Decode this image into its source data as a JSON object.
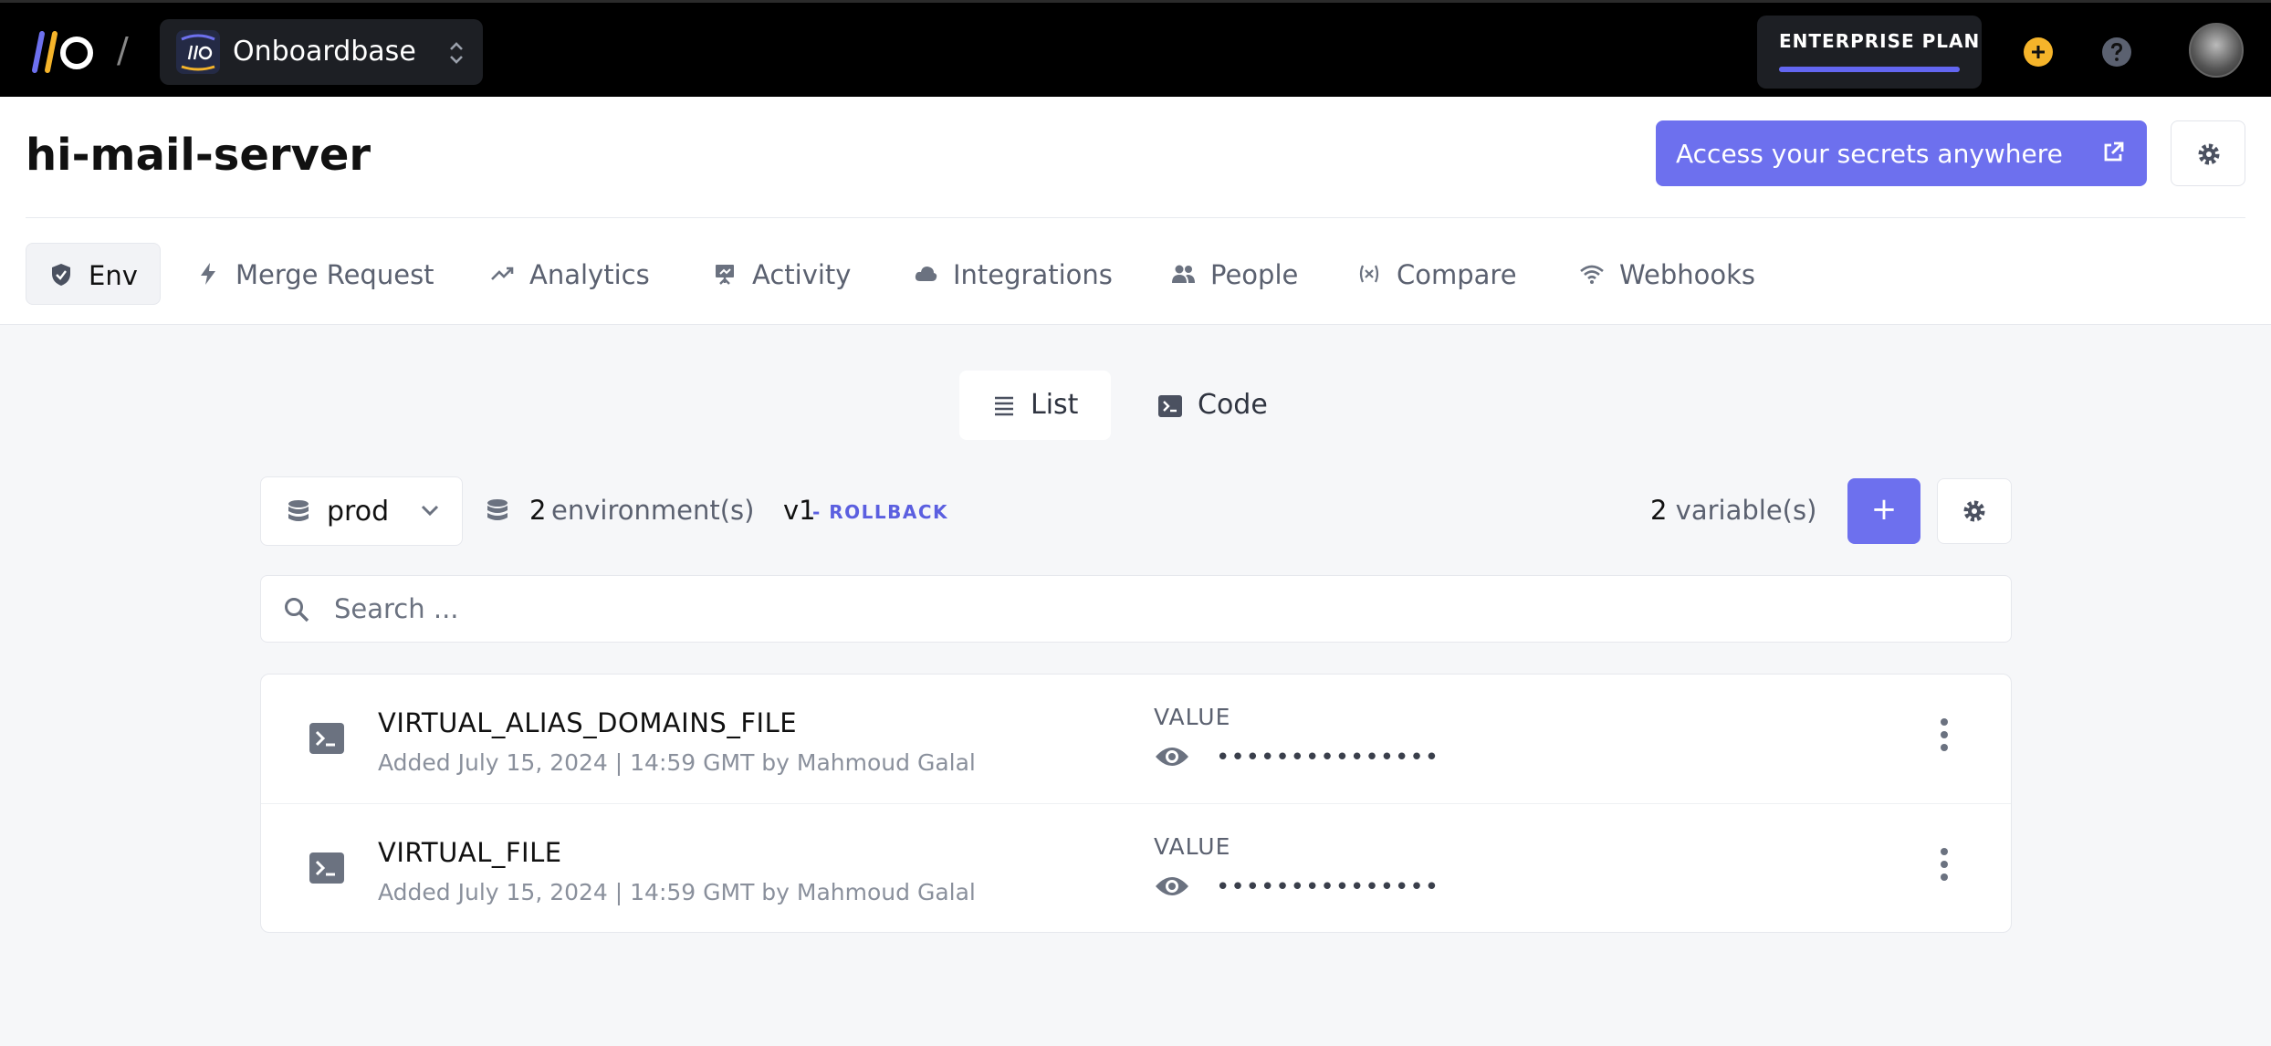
{
  "topbar": {
    "org_name": "Onboardbase",
    "plan_label": "ENTERPRISE PLAN",
    "plan_usage_fraction": 1.0,
    "colors": {
      "bg": "#000000",
      "accent": "#6366f1",
      "plus": "#f5b42a"
    }
  },
  "project": {
    "title": "hi-mail-server",
    "cta_label": "Access your secrets anywhere"
  },
  "tabs": [
    {
      "label": "Env",
      "icon": "shield-icon",
      "active": true
    },
    {
      "label": "Merge Request",
      "icon": "bolt-icon"
    },
    {
      "label": "Analytics",
      "icon": "trend-icon"
    },
    {
      "label": "Activity",
      "icon": "presentation-icon"
    },
    {
      "label": "Integrations",
      "icon": "cloud-icon"
    },
    {
      "label": "People",
      "icon": "people-icon"
    },
    {
      "label": "Compare",
      "icon": "variable-icon"
    },
    {
      "label": "Webhooks",
      "icon": "wifi-icon"
    }
  ],
  "view_toggle": {
    "list_label": "List",
    "code_label": "Code",
    "active": "List"
  },
  "toolbar": {
    "environment": "prod",
    "env_count": "2",
    "env_count_label": "environment(s)",
    "version": "v1",
    "rollback_label": "- ROLLBACK",
    "var_count": "2",
    "var_count_label": "variable(s)",
    "add_label": "+"
  },
  "search": {
    "placeholder": "Search ..."
  },
  "variables": [
    {
      "key": "VIRTUAL_ALIAS_DOMAINS_FILE",
      "meta": "Added July 15, 2024 | 14:59 GMT by Mahmoud Galal",
      "value_label": "VALUE",
      "masked": "•••••••••••••••"
    },
    {
      "key": "VIRTUAL_FILE",
      "meta": "Added July 15, 2024 | 14:59 GMT by Mahmoud Galal",
      "value_label": "VALUE",
      "masked": "•••••••••••••••"
    }
  ]
}
